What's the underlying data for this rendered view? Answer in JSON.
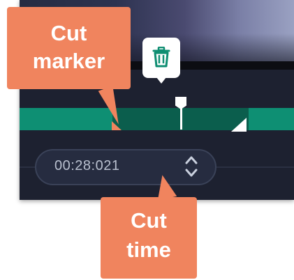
{
  "timeline": {
    "current_time": "00:28:021"
  },
  "callouts": {
    "cut_marker": [
      "Cut",
      "marker"
    ],
    "cut_time": [
      "Cut",
      "time"
    ]
  },
  "icons": {
    "delete": "trash-icon",
    "spinner": "up-down-chevron-icon"
  },
  "colors": {
    "accent": "#f0845e",
    "track": "#0e8f73",
    "track_selected": "#0b5e4d",
    "background": "#1d2130"
  }
}
